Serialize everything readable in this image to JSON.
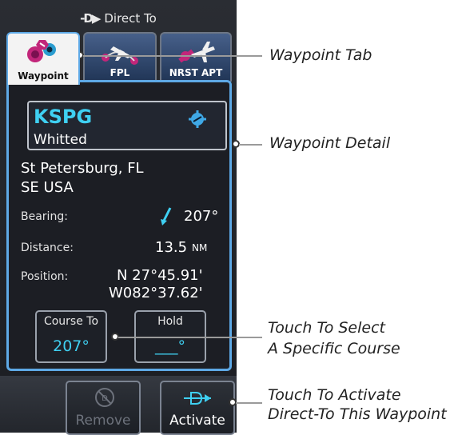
{
  "title_bar": {
    "glyph": "-D▶",
    "title": "Direct To"
  },
  "tabs": [
    {
      "label": "Waypoint",
      "active": true
    },
    {
      "label": "FPL",
      "active": false
    },
    {
      "label": "NRST APT",
      "active": false
    }
  ],
  "waypoint": {
    "ident": "KSPG",
    "name": "Whitted",
    "city": "St Petersburg, FL",
    "region": "SE USA"
  },
  "fields": {
    "bearing_label": "Bearing:",
    "bearing_value": "207°",
    "distance_label": "Distance:",
    "distance_value": "13.5",
    "distance_unit": "NM",
    "position_label": "Position:",
    "lat": "N 27°45.91'",
    "lon": "W082°37.62'"
  },
  "buttons": {
    "course_to_label": "Course To",
    "course_to_value": "207°",
    "hold_label": "Hold",
    "hold_value": "___°"
  },
  "bottom": {
    "remove_label": "Remove",
    "activate_label": "Activate"
  },
  "callouts": {
    "waypoint_tab": "Waypoint Tab",
    "waypoint_detail": "Waypoint Detail",
    "course_line1": "Touch To Select",
    "course_line2": "A Specific Course",
    "activate_line1": "Touch To Activate",
    "activate_line2": "Direct-To This Waypoint"
  },
  "colors": {
    "accent": "#5ea9e6",
    "ident": "#3fd0f2"
  }
}
